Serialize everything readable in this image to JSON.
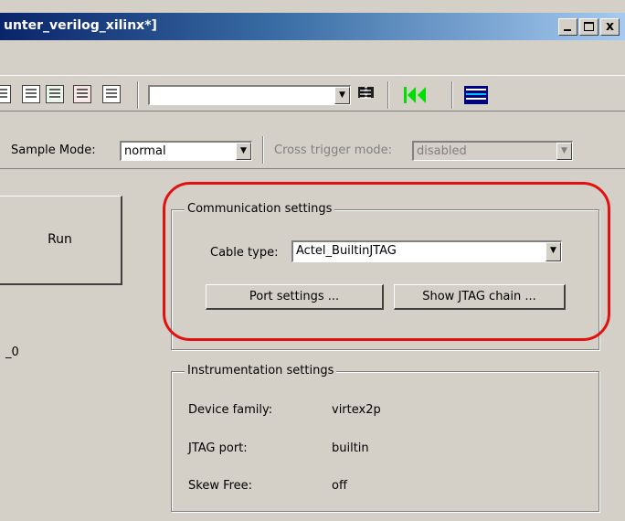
{
  "window": {
    "title": "unter_verilog_xilinx*]",
    "close_glyph": "x"
  },
  "toolbar": {
    "icons": [
      "hierarchy-icon",
      "hierarchy-arrow-icon",
      "signal-green-icon",
      "signal-red-icon",
      "find-icon",
      "go-first-icon",
      "waveform-icon"
    ],
    "search_combo_value": ""
  },
  "sample": {
    "mode_label": "Sample Mode:",
    "mode_value": "normal",
    "cross_trigger_label": "Cross trigger mode:",
    "cross_trigger_value": "disabled"
  },
  "left": {
    "run_label": "Run",
    "partial_text": "_0"
  },
  "communication": {
    "title": "Communication settings",
    "cable_label": "Cable type:",
    "cable_value": "Actel_BuiltinJTAG",
    "port_button": "Port settings ...",
    "chain_button": "Show JTAG chain ..."
  },
  "instrumentation": {
    "title": "Instrumentation settings",
    "rows": [
      {
        "label": "Device family:",
        "value": "virtex2p"
      },
      {
        "label": "JTAG port:",
        "value": "builtin"
      },
      {
        "label": "Skew Free:",
        "value": "off"
      }
    ]
  },
  "colors": {
    "face": "#d4d0c8",
    "highlight_ring": "#e31010",
    "title_start": "#0a246a",
    "title_end": "#a6caf0"
  }
}
